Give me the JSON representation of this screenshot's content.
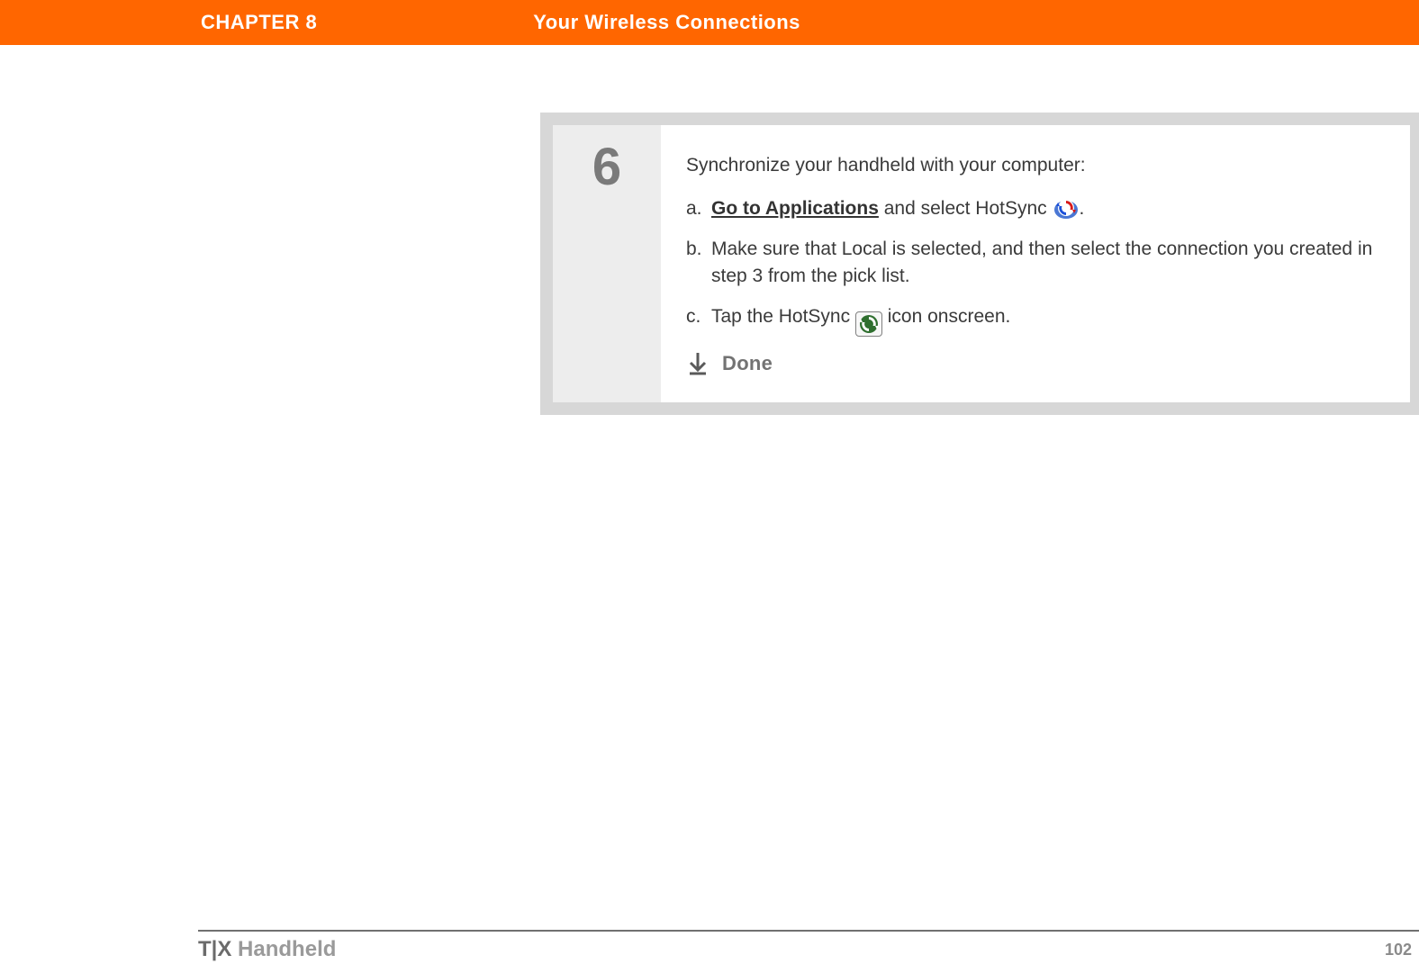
{
  "header": {
    "chapter_label": "CHAPTER 8",
    "chapter_title": "Your Wireless Connections"
  },
  "step": {
    "number": "6",
    "lead": "Synchronize your handheld with your computer:",
    "substeps": {
      "a": {
        "letter": "a.",
        "link_text": "Go to Applications",
        "after_link": " and select HotSync ",
        "period": "."
      },
      "b": {
        "letter": "b.",
        "text": "Make sure that Local is selected, and then select the connection you created in step 3 from the pick list."
      },
      "c": {
        "letter": "c.",
        "before_icon": "Tap the HotSync ",
        "after_icon": " icon onscreen."
      }
    },
    "done_label": "Done"
  },
  "footer": {
    "product_bold": "T|X",
    "product_rest": " Handheld",
    "page_number": "102"
  }
}
